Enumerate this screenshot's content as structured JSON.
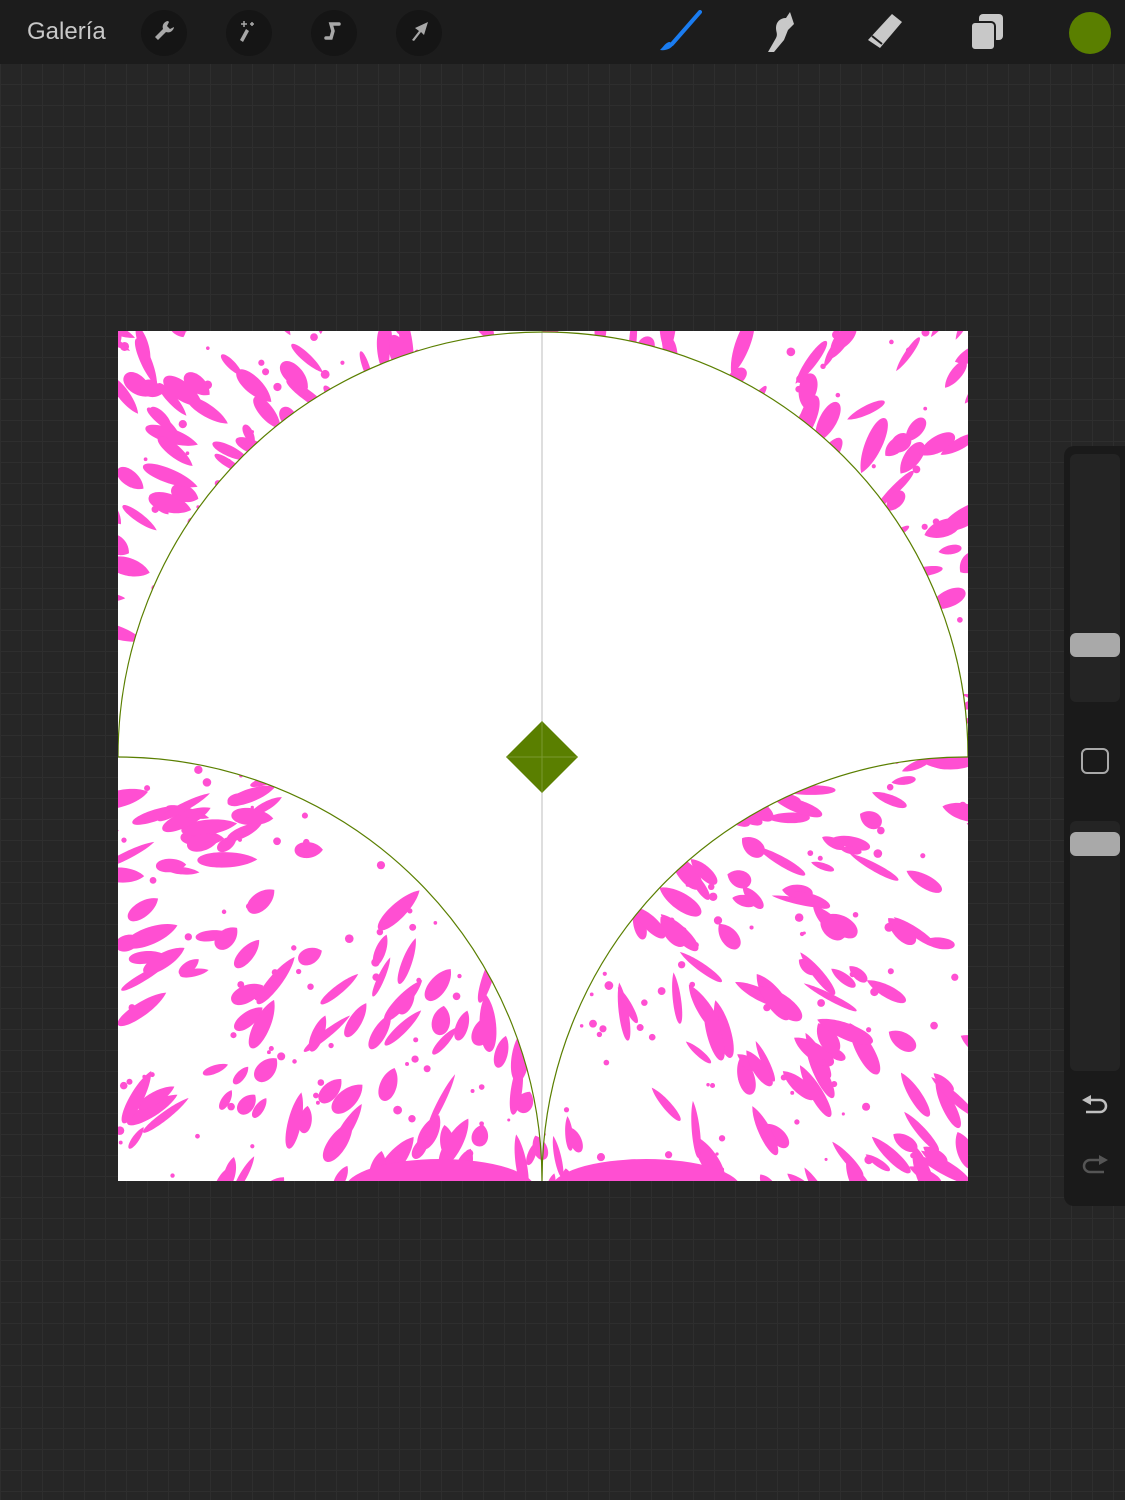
{
  "topbar": {
    "gallery_label": "Galería",
    "left_tools": [
      "wrench-icon",
      "magic-wand-icon",
      "selection-icon",
      "transform-arrow-icon"
    ],
    "right_tools": [
      "brush-icon",
      "smudge-icon",
      "eraser-icon",
      "layers-icon"
    ],
    "active_tool": "brush",
    "current_color": "#5a7f00",
    "brush_color": "#1a7cf0"
  },
  "colors": {
    "pattern": "#ff4fd2",
    "guide": "#5a7f00",
    "canvas": "#ffffff"
  },
  "sidebar": {
    "brush_size": 0.2,
    "opacity": 0.95,
    "modify_button": "square-icon",
    "undo": "undo-icon",
    "redo": "redo-icon"
  }
}
